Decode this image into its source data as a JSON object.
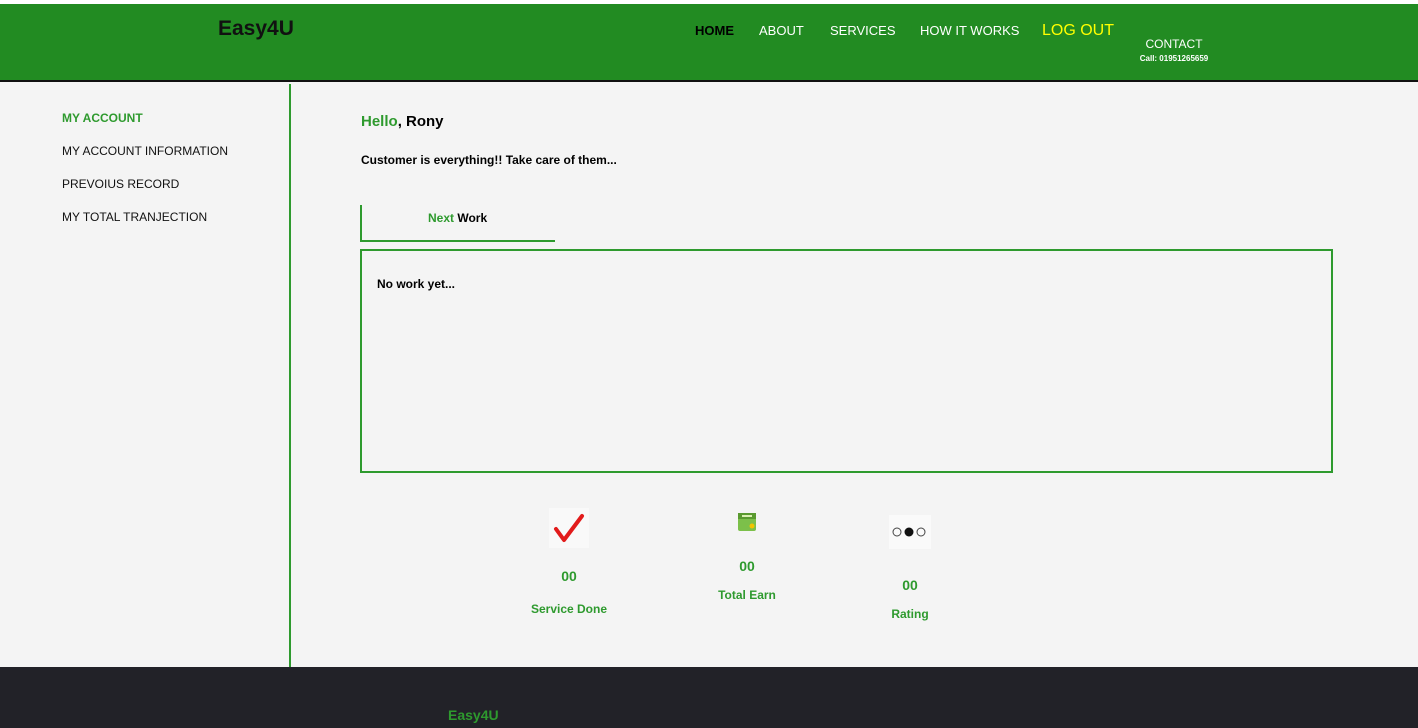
{
  "header": {
    "brand": "Easy4U",
    "nav": [
      {
        "label": "HOME",
        "active": true
      },
      {
        "label": "ABOUT"
      },
      {
        "label": "SERVICES"
      },
      {
        "label": "HOW IT WORKS"
      },
      {
        "label": "LOG OUT"
      }
    ],
    "contact": {
      "label": "CONTACT",
      "call": "Call: 01951265659"
    }
  },
  "sidebar": {
    "items": [
      {
        "label": "MY ACCOUNT",
        "active": true
      },
      {
        "label": "MY ACCOUNT INFORMATION"
      },
      {
        "label": "PREVOIUS RECORD"
      },
      {
        "label": "MY TOTAL TRANJECTION"
      }
    ]
  },
  "main": {
    "greeting_prefix": "Hello",
    "greeting_name": ", Rony",
    "tagline": "Customer is everything!! Take care of them...",
    "tab": {
      "highlight": "Next",
      "rest": " Work"
    },
    "work_message": "No work yet..."
  },
  "stats": [
    {
      "value": "00",
      "label": "Service Done",
      "icon": "checkmark-icon"
    },
    {
      "value": "00",
      "label": "Total Earn",
      "icon": "wallet-icon"
    },
    {
      "value": "00",
      "label": "Rating",
      "icon": "rating-faces-icon"
    }
  ],
  "footer": {
    "brand": "Easy4U"
  },
  "colors": {
    "header_green": "#228b22",
    "accent_green": "#2e9a2e",
    "logout_yellow": "#ffff00",
    "footer_dark": "#222228"
  }
}
